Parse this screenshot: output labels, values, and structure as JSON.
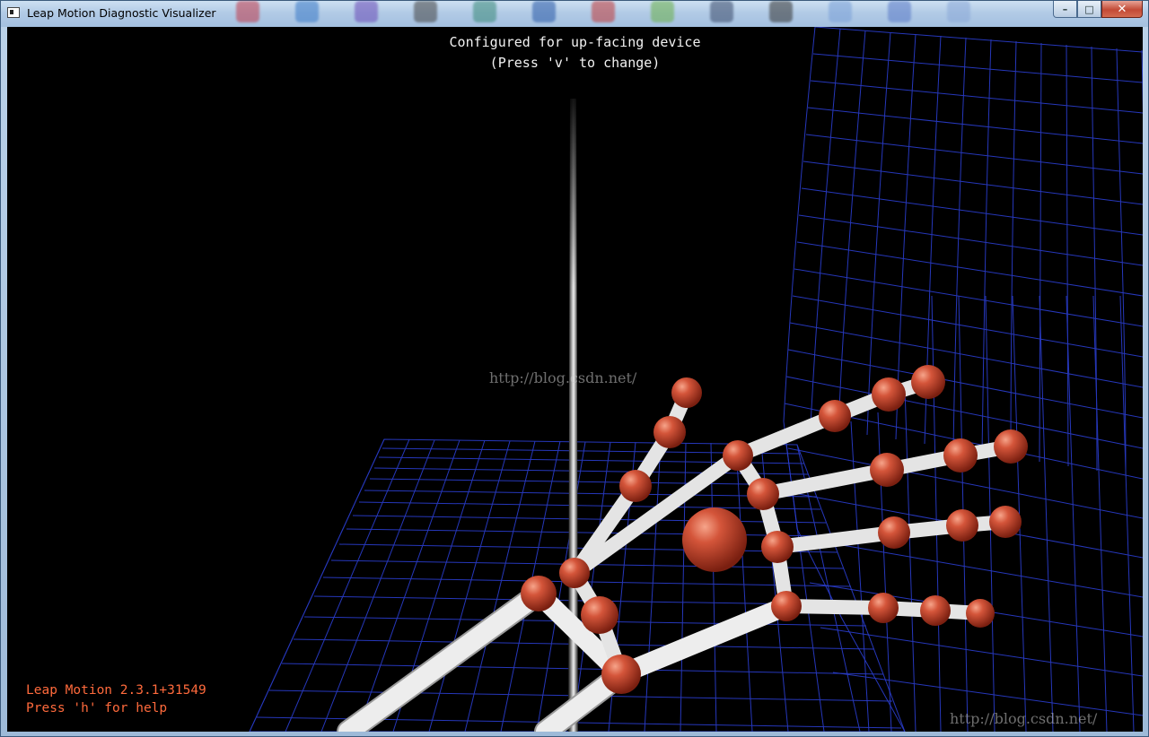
{
  "window": {
    "title": "Leap Motion Diagnostic Visualizer",
    "minimize_symbol": "–",
    "maximize_symbol": "□",
    "close_symbol": "✕"
  },
  "hud": {
    "config_line1": "Configured for up-facing device",
    "config_line2": "(Press 'v' to change)",
    "version": "Leap Motion 2.3.1+31549",
    "help": "Press 'h' for help"
  },
  "watermarks": {
    "center": "http://blog.csdn.net/",
    "bottom_right": "http://blog.csdn.net/"
  },
  "colors": {
    "background": "#000000",
    "grid": "#2b3ecf",
    "joint": "#c4462e",
    "bone": "#e8e8e8",
    "version_text": "#ff6a3c",
    "hud_text": "#f2f2f2"
  }
}
